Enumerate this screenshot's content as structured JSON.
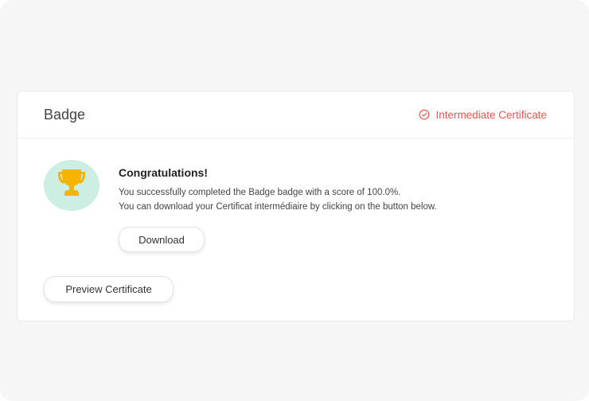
{
  "card": {
    "title": "Badge",
    "status": {
      "label": "Intermediate Certificate",
      "icon": "check-circle-icon",
      "color": "#ef5350"
    }
  },
  "achievement": {
    "icon": "trophy-icon",
    "icon_color": "#f5b400",
    "circle_color": "#cdeee2",
    "title": "Congratulations!",
    "line1": "You successfully completed the Badge badge with a score of 100.0%.",
    "line2": "You can download your Certificat intermédiaire by clicking on the button below."
  },
  "buttons": {
    "download_label": "Download",
    "preview_label": "Preview Certificate"
  }
}
